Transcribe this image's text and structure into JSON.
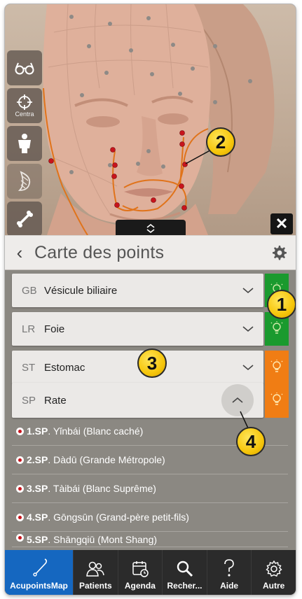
{
  "viewer": {
    "toolbar": [
      {
        "icon": "glasses-icon",
        "label": ""
      },
      {
        "icon": "crosshair-icon",
        "label": "Centra"
      },
      {
        "icon": "body-icon",
        "label": ""
      },
      {
        "icon": "muscle-icon",
        "label": ""
      },
      {
        "icon": "bone-icon",
        "label": ""
      }
    ],
    "close_label": "✕"
  },
  "panel": {
    "title": "Carte des points",
    "back_icon": "‹"
  },
  "meridians": [
    {
      "code": "GB",
      "name": "Vésicule biliaire",
      "color": "#1a9a2e",
      "expanded": false
    },
    {
      "code": "LR",
      "name": "Foie",
      "color": "#1a9a2e",
      "expanded": false
    },
    {
      "code": "ST",
      "name": "Estomac",
      "color": "#f07d14",
      "expanded": false
    },
    {
      "code": "SP",
      "name": "Rate",
      "color": "#f07d14",
      "expanded": true
    }
  ],
  "points": [
    {
      "code": "1.SP",
      "name": ". Yǐnbái (Blanc caché)"
    },
    {
      "code": "2.SP",
      "name": ". Dàdū (Grande Métropole)"
    },
    {
      "code": "3.SP",
      "name": ". Tàibái (Blanc Suprême)"
    },
    {
      "code": "4.SP",
      "name": ". Gōngsūn (Grand-père petit-fils)"
    },
    {
      "code": "5.SP",
      "name": ". Shāngqiū (Mont Shang)"
    }
  ],
  "callouts": [
    "1",
    "2",
    "3",
    "4"
  ],
  "tabs": [
    {
      "label": "AcupointsMap",
      "icon": "needle-icon",
      "active": true
    },
    {
      "label": "Patients",
      "icon": "patients-icon",
      "active": false
    },
    {
      "label": "Agenda",
      "icon": "calendar-icon",
      "active": false
    },
    {
      "label": "Recher...",
      "icon": "search-icon",
      "active": false
    },
    {
      "label": "Aide",
      "icon": "help-icon",
      "active": false
    },
    {
      "label": "Autre",
      "icon": "gear-icon",
      "active": false
    }
  ],
  "colors": {
    "accent": "#1567c0",
    "meridian_line": "#e0731a",
    "point_red": "#c8141c",
    "callout_yellow": "#f6c60b"
  }
}
